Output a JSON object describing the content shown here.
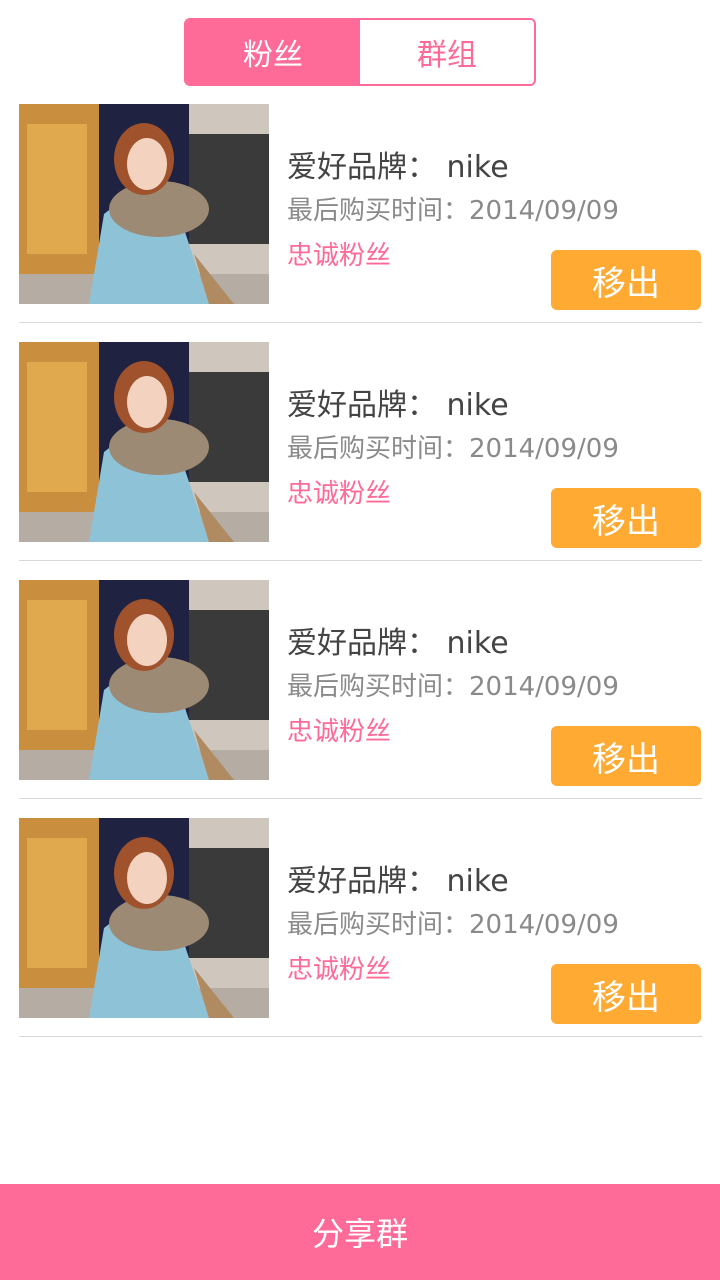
{
  "tabs": [
    {
      "label": "粉丝",
      "active": true
    },
    {
      "label": "群组",
      "active": false
    }
  ],
  "fans": [
    {
      "brand": "爱好品牌： nike",
      "last_purchase": "最后购买时间：2014/09/09",
      "tag": "忠诚粉丝",
      "action": "移出"
    },
    {
      "brand": "爱好品牌： nike",
      "last_purchase": "最后购买时间：2014/09/09",
      "tag": "忠诚粉丝",
      "action": "移出"
    },
    {
      "brand": "爱好品牌： nike",
      "last_purchase": "最后购买时间：2014/09/09",
      "tag": "忠诚粉丝",
      "action": "移出"
    },
    {
      "brand": "爱好品牌： nike",
      "last_purchase": "最后购买时间：2014/09/09",
      "tag": "忠诚粉丝",
      "action": "移出"
    }
  ],
  "bottom": {
    "share_label": "分享群"
  },
  "colors": {
    "accent": "#ff6b99",
    "button": "#ffaa33",
    "text_primary": "#444444",
    "text_secondary": "#8a8a8a"
  }
}
